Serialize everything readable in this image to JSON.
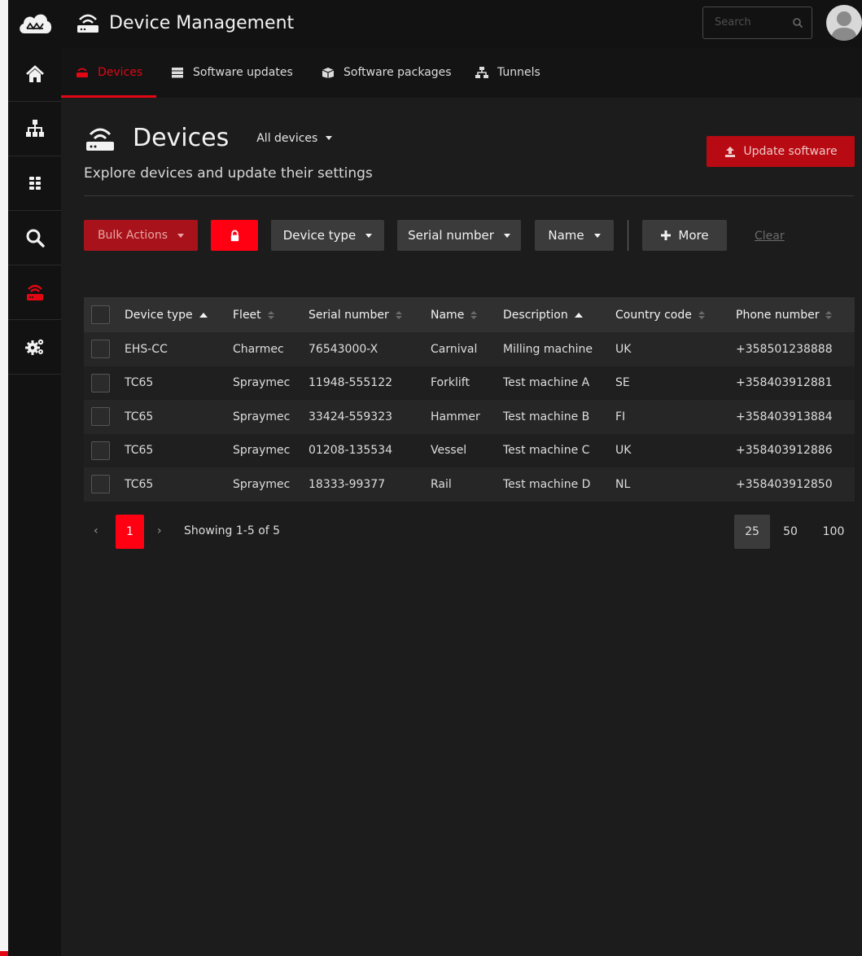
{
  "app": {
    "title": "Device Management"
  },
  "search": {
    "placeholder": "Search"
  },
  "subnav": {
    "tabs": [
      {
        "label": "Devices",
        "active": true
      },
      {
        "label": "Software updates"
      },
      {
        "label": "Software packages"
      },
      {
        "label": "Tunnels"
      }
    ]
  },
  "page": {
    "title": "Devices",
    "filter_label": "All devices",
    "subtitle": "Explore devices and update their settings",
    "update_button": "Update software"
  },
  "toolbar": {
    "bulk_actions": "Bulk Actions",
    "device_type": "Device type",
    "serial_number": "Serial number",
    "name": "Name",
    "more": "More",
    "clear": "Clear"
  },
  "table": {
    "headers": [
      "Device type",
      "Fleet",
      "Serial number",
      "Name",
      "Description",
      "Country code",
      "Phone number"
    ],
    "rows": [
      [
        "EHS-CC",
        "Charmec",
        "76543000-X",
        "Carnival",
        "Milling machine",
        "UK",
        "+358501238888"
      ],
      [
        "TC65",
        "Spraymec",
        "11948-555122",
        "Forklift",
        "Test machine A",
        "SE",
        "+358403912881"
      ],
      [
        "TC65",
        "Spraymec",
        "33424-559323",
        "Hammer",
        "Test machine B",
        "FI",
        "+358403913884"
      ],
      [
        "TC65",
        "Spraymec",
        "01208-135534",
        "Vessel",
        "Test machine C",
        "UK",
        "+358403912886"
      ],
      [
        "TC65",
        "Spraymec",
        "18333-99377",
        "Rail",
        "Test machine D",
        "NL",
        "+358403912850"
      ]
    ]
  },
  "pagination": {
    "prev": "‹",
    "current_page": "1",
    "next": "›",
    "info": "Showing 1-5 of 5",
    "page_sizes": [
      "25",
      "50",
      "100"
    ],
    "selected_page_size": "25"
  },
  "colors": {
    "accent": "#e30613",
    "background": "#1c1c1c",
    "topbar": "#121212"
  },
  "icons": {
    "sidebar": [
      "home-icon",
      "sitemap-icon",
      "apps-icon",
      "search-icon",
      "router-icon",
      "gears-icon"
    ]
  }
}
